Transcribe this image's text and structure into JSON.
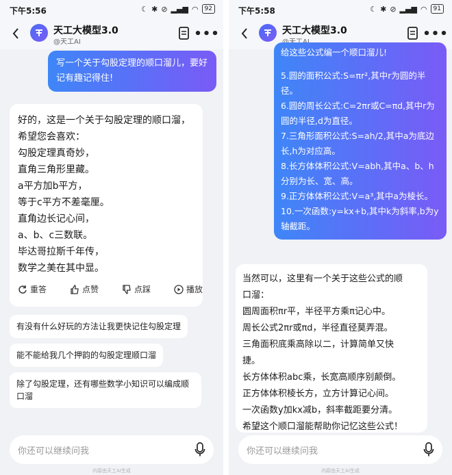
{
  "left": {
    "status": {
      "time": "下午5:56",
      "battery": "92"
    },
    "header": {
      "title": "天工大模型3.0",
      "subtitle": "@天工AI"
    },
    "user_message": [
      "写一个关于勾股定理的顺口溜儿，要好",
      "记有趣记得住!"
    ],
    "ai_lines": [
      "好的，这是一个关于勾股定理的顺口溜，",
      "希望您会喜欢：",
      "勾股定理真奇妙，",
      "直角三角形里藏。",
      "a平方加b平方，",
      "等于c平方不差毫厘。",
      "直角边长记心间，",
      "a、b、c三数联。",
      "毕达哥拉斯千年传，",
      "数学之美在其中显。"
    ],
    "actions": {
      "retry": "重答",
      "like": "点赞",
      "dislike": "点踩",
      "play": "播放"
    },
    "suggestions": [
      [
        "有没有什么好玩的方法让我更快记住勾股定理"
      ],
      [
        "能不能给我几个押韵的勾股定理顺口溜"
      ],
      [
        "除了勾股定理，还有哪些数学小知识可以编成顺",
        "口溜"
      ]
    ],
    "input_placeholder": "你还可以继续问我",
    "footnote": "内容由天工AI生成"
  },
  "right": {
    "status": {
      "time": "下午5:58",
      "battery": "91"
    },
    "header": {
      "title": "天工大模型3.0",
      "subtitle": "@天工AI"
    },
    "user_message": [
      "给这些公式编一个顺口溜儿!",
      "",
      "5.圆的面积公式:S=πr²,其中r为圆的半",
      "径。",
      "6.圆的周长公式:C=2πr或C=πd,其中r为",
      "圆的半径,d为直径。",
      "7.三角形面积公式:S=ah/2,其中a为底边",
      "长,h为对应高。",
      "8.长方体体积公式:V=abh,其中a、b、h",
      "分别为长、宽、高。",
      "9.正方体体积公式:V=a³,其中a为棱长。",
      "10.一次函数:y=kx+b,其中k为斜率,b为y",
      "轴截距。"
    ],
    "ai_lines": [
      "当然可以，这里有一个关于这些公式的顺",
      "口溜：",
      "圆周面积πr平，半径平方乘π记心中。",
      "周长公式2πr或πd，半径直径莫弄混。",
      "三角面积底乘高除以二，计算简单又快",
      "捷。",
      "长方体体积abc乘，长宽高顺序别颠倒。",
      "正方体体积棱长方，立方计算记心间。",
      "一次函数y加kx减b，斜率截距要分清。",
      "希望这个顺口溜能帮助你记忆这些公式！"
    ],
    "input_placeholder": "你还可以继续问我",
    "footnote": "内容由天工AI生成"
  }
}
